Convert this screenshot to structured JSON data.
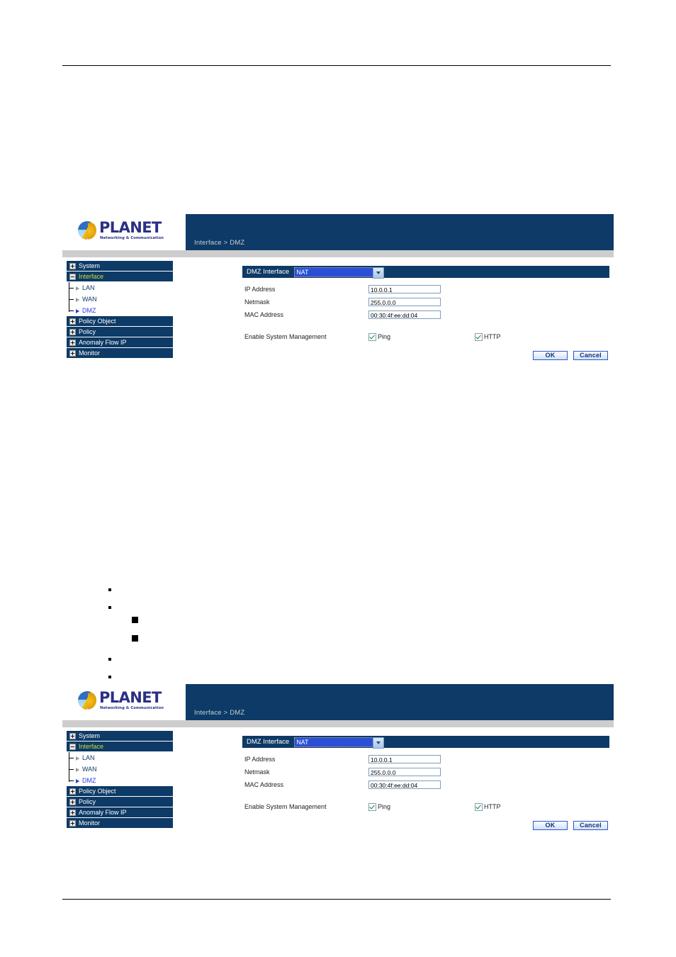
{
  "panels": [
    {
      "logo": {
        "word": "PLANET",
        "tagline": "Networking & Communication"
      },
      "breadcrumb": "Interface > DMZ",
      "sidebar": {
        "groups": [
          {
            "label": "System",
            "expanded": false
          },
          {
            "label": "Interface",
            "expanded": true,
            "active": true
          },
          {
            "label": "Policy Object",
            "expanded": false
          },
          {
            "label": "Policy",
            "expanded": false
          },
          {
            "label": "Anomaly Flow IP",
            "expanded": false
          },
          {
            "label": "Monitor",
            "expanded": false
          }
        ],
        "sub_items": [
          {
            "label": "LAN",
            "current": false
          },
          {
            "label": "WAN",
            "current": false
          },
          {
            "label": "DMZ",
            "current": true
          }
        ]
      },
      "form": {
        "title": "DMZ Interface",
        "mode_value": "NAT",
        "fields": [
          {
            "label": "IP Address",
            "value": "10.0.0.1"
          },
          {
            "label": "Netmask",
            "value": "255.0.0.0"
          },
          {
            "label": "MAC Address",
            "value": "00:30:4f:ee:dd:04"
          }
        ],
        "management_label": "Enable System Management",
        "management_options": [
          {
            "label": "Ping",
            "checked": true
          },
          {
            "label": "HTTP",
            "checked": true
          }
        ],
        "ok_label": "OK",
        "cancel_label": "Cancel"
      }
    },
    {
      "logo": {
        "word": "PLANET",
        "tagline": "Networking & Communication"
      },
      "breadcrumb": "Interface > DMZ",
      "sidebar": {
        "groups": [
          {
            "label": "System",
            "expanded": false
          },
          {
            "label": "Interface",
            "expanded": true,
            "active": true
          },
          {
            "label": "Policy Object",
            "expanded": false
          },
          {
            "label": "Policy",
            "expanded": false
          },
          {
            "label": "Anomaly Flow IP",
            "expanded": false
          },
          {
            "label": "Monitor",
            "expanded": false
          }
        ],
        "sub_items": [
          {
            "label": "LAN",
            "current": false
          },
          {
            "label": "WAN",
            "current": false
          },
          {
            "label": "DMZ",
            "current": true
          }
        ]
      },
      "form": {
        "title": "DMZ Interface",
        "mode_value": "NAT",
        "fields": [
          {
            "label": "IP Address",
            "value": "10.0.0.1"
          },
          {
            "label": "Netmask",
            "value": "255.0.0.0"
          },
          {
            "label": "MAC Address",
            "value": "00:30:4f:ee:dd:04"
          }
        ],
        "management_label": "Enable System Management",
        "management_options": [
          {
            "label": "Ping",
            "checked": true
          },
          {
            "label": "HTTP",
            "checked": true
          }
        ],
        "ok_label": "OK",
        "cancel_label": "Cancel"
      }
    }
  ],
  "colors": {
    "navy": "#0d3a66",
    "brand_text": "#2b2f86",
    "active_nav": "#cddc39",
    "current_link": "#2a3ddd",
    "select_highlight": "#2a4fd6",
    "check_green": "#1a8a22",
    "gray_bar": "#cdcdcd"
  }
}
